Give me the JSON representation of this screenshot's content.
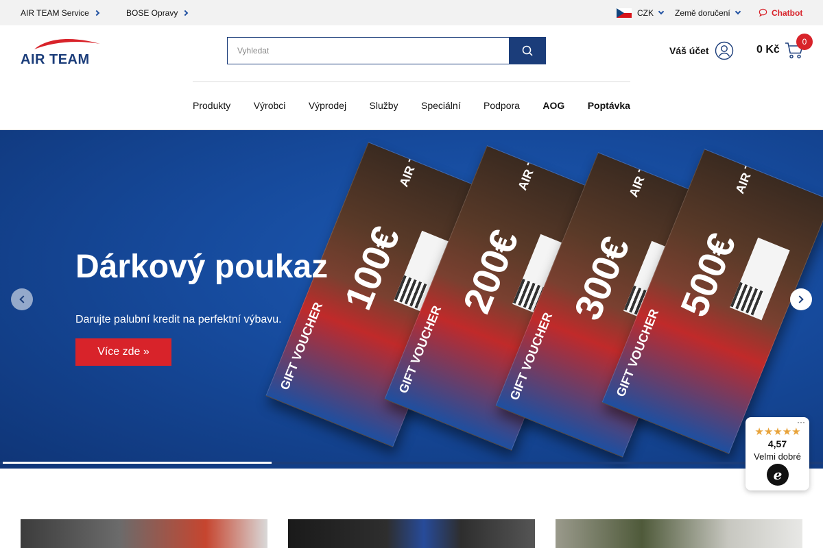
{
  "topbar": {
    "links": [
      {
        "label": "AIR TEAM Service"
      },
      {
        "label": "BOSE Opravy"
      }
    ],
    "currency": "CZK",
    "country_label": "Země doručení",
    "chatbot_label": "Chatbot"
  },
  "header": {
    "logo_text": "AIR TEAM",
    "search_placeholder": "Vyhledat",
    "account_label": "Váš účet",
    "cart_total": "0 Kč",
    "cart_count": "0"
  },
  "nav": {
    "items": [
      "Produkty",
      "Výrobci",
      "Výprodej",
      "Služby",
      "Speciální",
      "Podpora",
      "AOG",
      "Poptávka"
    ]
  },
  "hero": {
    "title": "Dárkový poukaz",
    "subtitle": " Darujte palubní kredit na perfektní výbavu.",
    "button": "Více zde »",
    "vouchers": [
      {
        "amount": "100€",
        "tag": "GIFT VOUCHER",
        "brand": "AIR TEAM"
      },
      {
        "amount": "200€",
        "tag": "GIFT VOUCHER",
        "brand": "AIR TEAM"
      },
      {
        "amount": "300€",
        "tag": "GIFT VOUCHER",
        "brand": "AIR TEAM"
      },
      {
        "amount": "500€",
        "tag": "GIFT VOUCHER",
        "brand": "AIR TEAM"
      }
    ]
  },
  "rating": {
    "stars": "★★★★★",
    "score": "4,57",
    "quality": "Velmi dobré",
    "mark": "e"
  },
  "colors": {
    "brand_blue": "#1b3d7a",
    "accent_red": "#d8232a"
  },
  "icons": {
    "search": "search-icon",
    "account": "user-icon",
    "cart": "cart-icon",
    "chat": "chat-bubble-icon"
  }
}
